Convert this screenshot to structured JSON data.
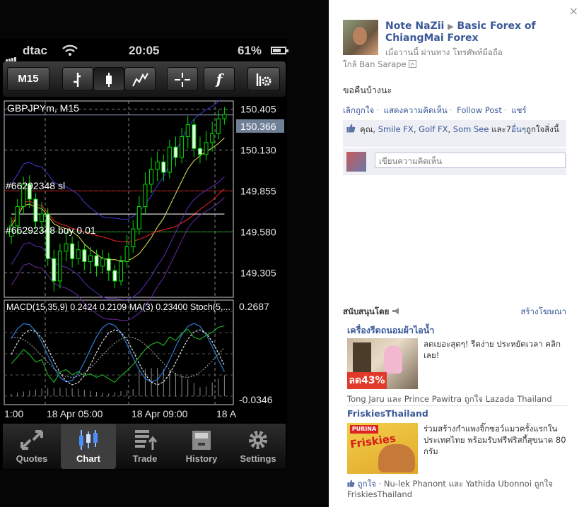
{
  "status": {
    "carrier": "dtac",
    "time": "20:05",
    "battery": "61%",
    "battery_level": 0.61
  },
  "toolbar": {
    "timeframe_label": "M15",
    "indicator_label": "f"
  },
  "chart": {
    "symbol": "GBPJPYm, M15",
    "indicator_title": "MACD(15,35,9) 0.2424 0.2109 MA(3) 0.23400 Stoch(5,...",
    "sl_label": "#66292348 sl",
    "buy_label": "#66292348 buy 0.01",
    "current_price": "150.366"
  },
  "chart_data": {
    "type": "candlestick",
    "symbol": "GBPJPYm, M15",
    "price_ticks": [
      "150.405",
      "150.130",
      "149.855",
      "149.580",
      "149.305"
    ],
    "price_ylim": [
      149.15,
      150.45
    ],
    "current_price": 150.366,
    "indicator_ticks": [
      "0.2687",
      "-0.0346"
    ],
    "time_ticks": [
      "1:00",
      "18 Apr 05:00",
      "18 Apr 09:00",
      "18 A"
    ],
    "sl_price": 149.855,
    "buy_price": 149.58,
    "candles": [
      [
        149.55,
        149.62,
        149.5,
        149.68
      ],
      [
        149.62,
        149.75,
        149.56,
        149.8
      ],
      [
        149.75,
        149.9,
        149.7,
        149.95
      ],
      [
        149.9,
        149.8,
        149.74,
        149.96
      ],
      [
        149.8,
        149.65,
        149.6,
        149.84
      ],
      [
        149.65,
        149.7,
        149.58,
        149.78
      ],
      [
        149.7,
        149.4,
        149.35,
        149.74
      ],
      [
        149.4,
        149.25,
        149.18,
        149.46
      ],
      [
        149.25,
        149.45,
        149.2,
        149.5
      ],
      [
        149.45,
        149.5,
        149.38,
        149.58
      ],
      [
        149.5,
        149.4,
        149.34,
        149.55
      ],
      [
        149.4,
        149.46,
        149.36,
        149.52
      ],
      [
        149.46,
        149.38,
        149.32,
        149.5
      ],
      [
        149.38,
        149.42,
        149.3,
        149.48
      ],
      [
        149.42,
        149.35,
        149.28,
        149.46
      ],
      [
        149.35,
        149.4,
        149.3,
        149.46
      ],
      [
        149.4,
        149.32,
        149.25,
        149.44
      ],
      [
        149.32,
        149.25,
        149.2,
        149.36
      ],
      [
        149.25,
        149.38,
        149.22,
        149.42
      ],
      [
        149.38,
        149.48,
        149.34,
        149.56
      ],
      [
        149.48,
        149.6,
        149.44,
        149.66
      ],
      [
        149.6,
        149.75,
        149.56,
        149.82
      ],
      [
        149.75,
        149.9,
        149.7,
        149.98
      ],
      [
        149.9,
        150.0,
        149.84,
        150.08
      ],
      [
        150.0,
        150.05,
        149.92,
        150.12
      ],
      [
        150.05,
        149.98,
        149.92,
        150.1
      ],
      [
        149.98,
        150.15,
        149.94,
        150.2
      ],
      [
        150.15,
        150.08,
        150.02,
        150.22
      ],
      [
        150.08,
        150.22,
        150.04,
        150.28
      ],
      [
        150.22,
        150.3,
        150.14,
        150.36
      ],
      [
        150.3,
        150.14,
        150.08,
        150.34
      ],
      [
        150.14,
        150.1,
        150.04,
        150.22
      ],
      [
        150.1,
        150.18,
        150.06,
        150.26
      ],
      [
        150.18,
        150.24,
        150.12,
        150.32
      ],
      [
        150.24,
        150.34,
        150.2,
        150.4
      ],
      [
        150.34,
        150.37,
        150.3,
        150.42
      ]
    ]
  },
  "tabs": [
    {
      "label": "Quotes"
    },
    {
      "label": "Chart"
    },
    {
      "label": "Trade"
    },
    {
      "label": "History"
    },
    {
      "label": "Settings"
    }
  ],
  "fb": {
    "close": "×",
    "author": "Note NaZii",
    "arrow": "▶",
    "target": "Basic Forex of ChiangMai Forex",
    "meta": "เมื่อวานนี้ ผ่านทาง โทรศัพท์มือถือ",
    "location": "ใกล้ Ban Sarape",
    "message": "ขอคืนบ้างนะ",
    "actions": [
      "เลิกถูกใจ",
      "แสดงความคิดเห็น",
      "Follow Post",
      "แชร์"
    ],
    "likes_prefix": "คุณ,",
    "likers": [
      "Smile FX",
      "Golf FX",
      "Som See"
    ],
    "likes_others_link": "อื่นๆ",
    "likes_mid": "และ7",
    "likes_suffix": "ถูกใจสิ่งนี้",
    "comment_placeholder": "เขียนความคิดเห็น",
    "sponsored": "สนับสนุนโดย",
    "create_ad": "สร้างโฆษณา",
    "ads": [
      {
        "title": "เครื่องรีดถนอมผ้าไอน้ำ",
        "text": "ลดเยอะสุดๆ! รีดง่าย ประหยัดเวลา คลิกเลย!",
        "badge": "ลด43%",
        "social": "Tong Jaru และ Prince Pawitra ถูกใจ Lazada Thailand"
      },
      {
        "title": "FriskiesThailand",
        "text": "ร่วมสร้างกำแพงจิ๊กซอว์แมวครั้งแรกในประเทศไทย พร้อมรับฟรีฟริสกี้สุขนาด 80 กรัม",
        "brand_top": "PURINA",
        "brand": "Friskies",
        "social_like": "ถูกใจ",
        "social": "· Nu-lek Phanont และ Yathida Ubonnoi ถูกใจ FriskiesThailand"
      }
    ]
  }
}
